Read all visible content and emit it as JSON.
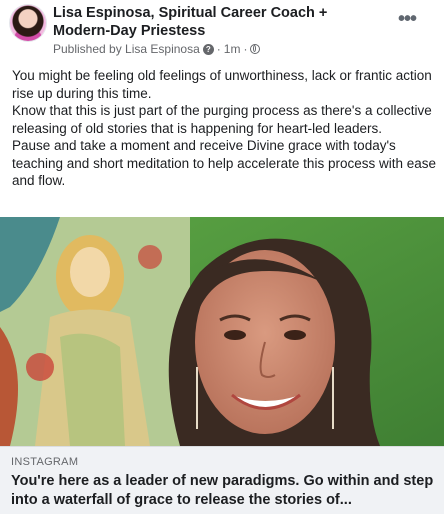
{
  "post": {
    "author": "Lisa Espinosa, Spiritual Career Coach + Modern-Day Priestess",
    "published_by": "Published by Lisa Espinosa",
    "separator": "·",
    "time": "1m",
    "more_icon": "more-horizontal-icon",
    "help_icon": "question-mark-icon",
    "audience_icon": "globe-icon"
  },
  "body": {
    "paragraphs": [
      "You might be feeling old feelings of unworthiness, lack or frantic action rise up during this time.",
      "Know that this is just part of the purging process as there's a collective releasing of old stories that is happening for heart-led leaders.",
      "Pause and take a moment and receive Divine grace with today's teaching and short meditation to help accelerate this process with ease and flow."
    ]
  },
  "link_preview": {
    "source": "INSTAGRAM",
    "title": "You're here as a leader of new paradigms. Go within and step into a waterfall of grace to release the stories of..."
  },
  "colors": {
    "meta_text": "#65676b",
    "link_box_bg": "#f0f2f5",
    "media_green": "#4d8f3c"
  }
}
